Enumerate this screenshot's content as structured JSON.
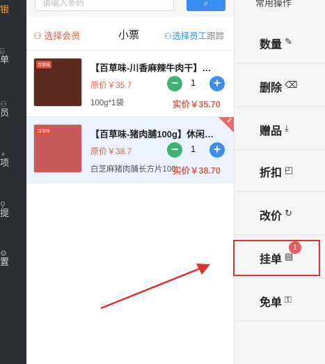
{
  "nav": {
    "items": [
      {
        "label": "银",
        "icon": "cash-icon",
        "active": true
      },
      {
        "label": "单",
        "icon": "order-icon"
      },
      {
        "label": "员",
        "icon": "member-icon"
      },
      {
        "label": "项",
        "icon": "item-icon"
      },
      {
        "label": "提",
        "icon": "commission-icon"
      },
      {
        "label": "置",
        "icon": "settings-icon"
      }
    ]
  },
  "search": {
    "placeholder": "请输入条码",
    "button": "Q"
  },
  "ticket": {
    "select_member": "选择会员",
    "title": "小票",
    "select_staff": "选择员工",
    "follow": "跟踪"
  },
  "items": [
    {
      "name": "【百草味-川香麻辣牛肉干】…",
      "orig_price": "原价￥35.7",
      "spec": "100g*1袋",
      "qty": "1",
      "real_price": "实价￥35.70",
      "brand": "百草味"
    },
    {
      "name": "【百草味-猪肉脯100g】休闲…",
      "orig_price": "原价￥38.7",
      "spec": "白芝麻猪肉脯长方片100…",
      "qty": "1",
      "real_price": "实价￥38.70",
      "brand": "百草味"
    }
  ],
  "ops": {
    "title": "常用操作",
    "buttons": [
      {
        "label": "数量",
        "icon": "edit-icon",
        "glyph": "✎"
      },
      {
        "label": "删除",
        "icon": "trash-icon",
        "glyph": "🗑"
      },
      {
        "label": "赠品",
        "icon": "download-icon",
        "glyph": "⤓"
      },
      {
        "label": "折扣",
        "icon": "discount-icon",
        "glyph": "◰"
      },
      {
        "label": "改价",
        "icon": "refresh-icon",
        "glyph": "↻"
      },
      {
        "label": "挂单",
        "icon": "document-icon",
        "glyph": "▤",
        "badge": "1"
      },
      {
        "label": "免单",
        "icon": "key-icon",
        "glyph": "⚿"
      }
    ]
  },
  "colors": {
    "accent": "#3b8ef0",
    "danger": "#e0604a",
    "highlight": "#e03030"
  }
}
